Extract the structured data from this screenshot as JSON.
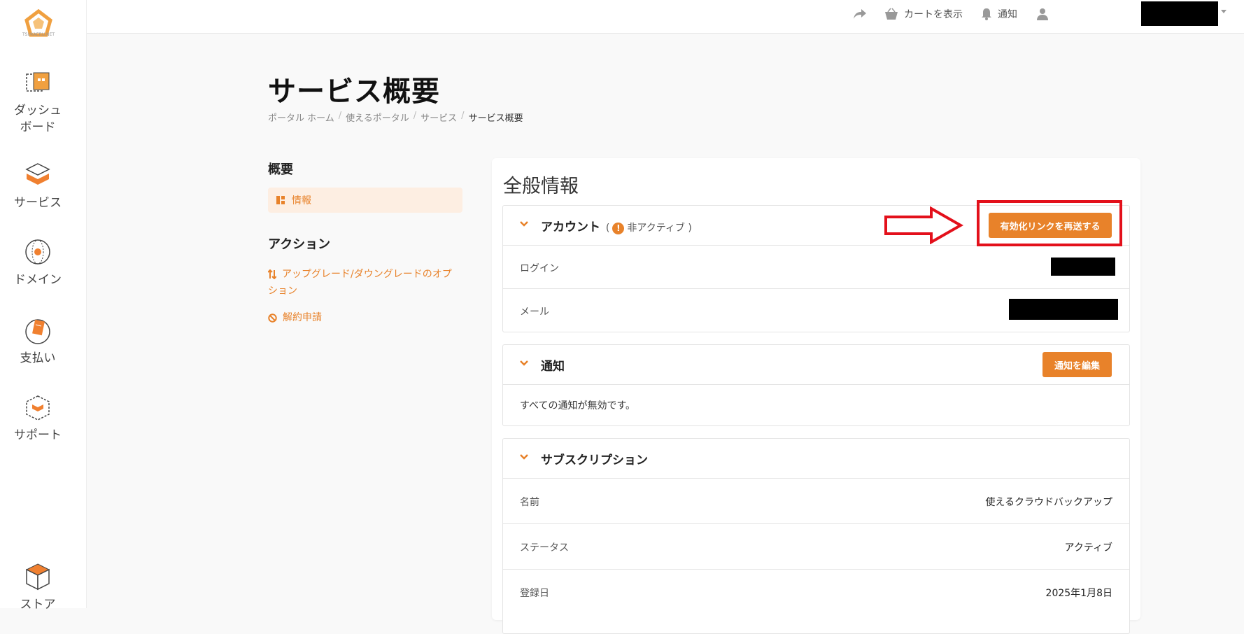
{
  "sidebar": {
    "logo_text": "TSUKAERU.NET",
    "items": [
      {
        "label": "ダッシュ\nボード",
        "icon": "dashboard-icon"
      },
      {
        "label": "サービス",
        "icon": "services-box-icon"
      },
      {
        "label": "ドメイン",
        "icon": "globe-icon"
      },
      {
        "label": "支払い",
        "icon": "billing-icon"
      },
      {
        "label": "サポート",
        "icon": "support-box-icon"
      },
      {
        "label": "ストア",
        "icon": "store-cube-icon"
      }
    ]
  },
  "topbar": {
    "share_icon": "share-arrow-icon",
    "cart_label": "カートを表示",
    "notifications_label": "通知",
    "user_icon": "user-icon"
  },
  "page": {
    "title": "サービス概要",
    "breadcrumb": [
      "ポータル ホーム",
      "使えるポータル",
      "サービス",
      "サービス概要"
    ]
  },
  "side_menu": {
    "overview_heading": "概要",
    "info_label": "情報",
    "actions_heading": "アクション",
    "upgrade_label_line1": "アップグレード/ダウングレードのオプ",
    "upgrade_label_line2": "ション",
    "cancel_label": "解約申請"
  },
  "card": {
    "title": "全般情報",
    "account": {
      "title": "アカウント",
      "status_open": "(",
      "status": "非アクティブ",
      "status_close": ")",
      "resend_button": "有効化リンクを再送する",
      "rows": [
        {
          "label": "ログイン"
        },
        {
          "label": "メール"
        }
      ]
    },
    "notifications": {
      "title": "通知",
      "edit_button": "通知を編集",
      "message": "すべての通知が無効です。"
    },
    "subscription": {
      "title": "サブスクリプション",
      "rows": [
        {
          "label": "名前",
          "value": "使えるクラウドバックアップ"
        },
        {
          "label": "ステータス",
          "value": "アクティブ"
        },
        {
          "label": "登録日",
          "value": "2025年1月8日"
        }
      ]
    }
  },
  "colors": {
    "accent": "#e8822a",
    "highlight": "#e3101b"
  }
}
